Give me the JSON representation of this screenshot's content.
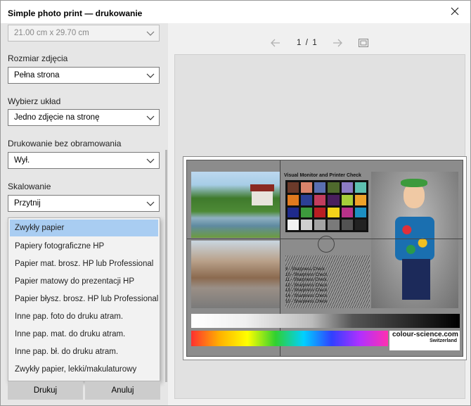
{
  "window": {
    "title": "Simple photo print — drukowanie"
  },
  "settings": {
    "paper_size_value": "21.00 cm x 29.70 cm",
    "photo_size_label": "Rozmiar zdjęcia",
    "photo_size_value": "Pełna strona",
    "layout_label": "Wybierz układ",
    "layout_value": "Jedno zdjęcie na stronę",
    "borderless_label": "Drukowanie bez obramowania",
    "borderless_value": "Wył.",
    "scaling_label": "Skalowanie",
    "scaling_value": "Przytnij"
  },
  "paper_type_options": [
    "Zwykły papier",
    "Papiery fotograficzne HP",
    "Papier mat. brosz. HP lub Professional",
    "Papier matowy do prezentacji HP",
    "Papier błysz. brosz. HP lub Professional",
    "Inne pap. foto do druku atram.",
    "Inne pap. mat. do druku atram.",
    "Inne pap. bł. do druku atram.",
    "Zwykły papier, lekki/makulaturowy"
  ],
  "preview": {
    "page_current": "1",
    "page_separator": "/",
    "page_total": "1",
    "chart_title": "Visual Monitor and Printer Check",
    "sharpness_lines": [
      "9 - Sharpness Check",
      "10 - Sharpness Check",
      "11 - Sharpness Check",
      "12 - Sharpness Check",
      "13 - Sharpness Check",
      "14 - Sharpness Check",
      "15 - Sharpness Check"
    ],
    "brand": "colour-science.com",
    "country": "Switzerland",
    "swatch_colors": [
      "#6b3a2a",
      "#d9836a",
      "#5a6fb0",
      "#4f6a2d",
      "#8c7bc4",
      "#5ec0b0",
      "#e07a1e",
      "#2c3f94",
      "#c33d5e",
      "#4a1f5e",
      "#a5cd3a",
      "#eea22a",
      "#1f2a8c",
      "#3d9a3d",
      "#b81e22",
      "#f2d21a",
      "#b8328a",
      "#1c8fc2",
      "#f2f2f2",
      "#cfcfcf",
      "#a3a3a3",
      "#7a7a7a",
      "#525252",
      "#222222"
    ]
  },
  "buttons": {
    "print": "Drukuj",
    "cancel": "Anuluj"
  }
}
